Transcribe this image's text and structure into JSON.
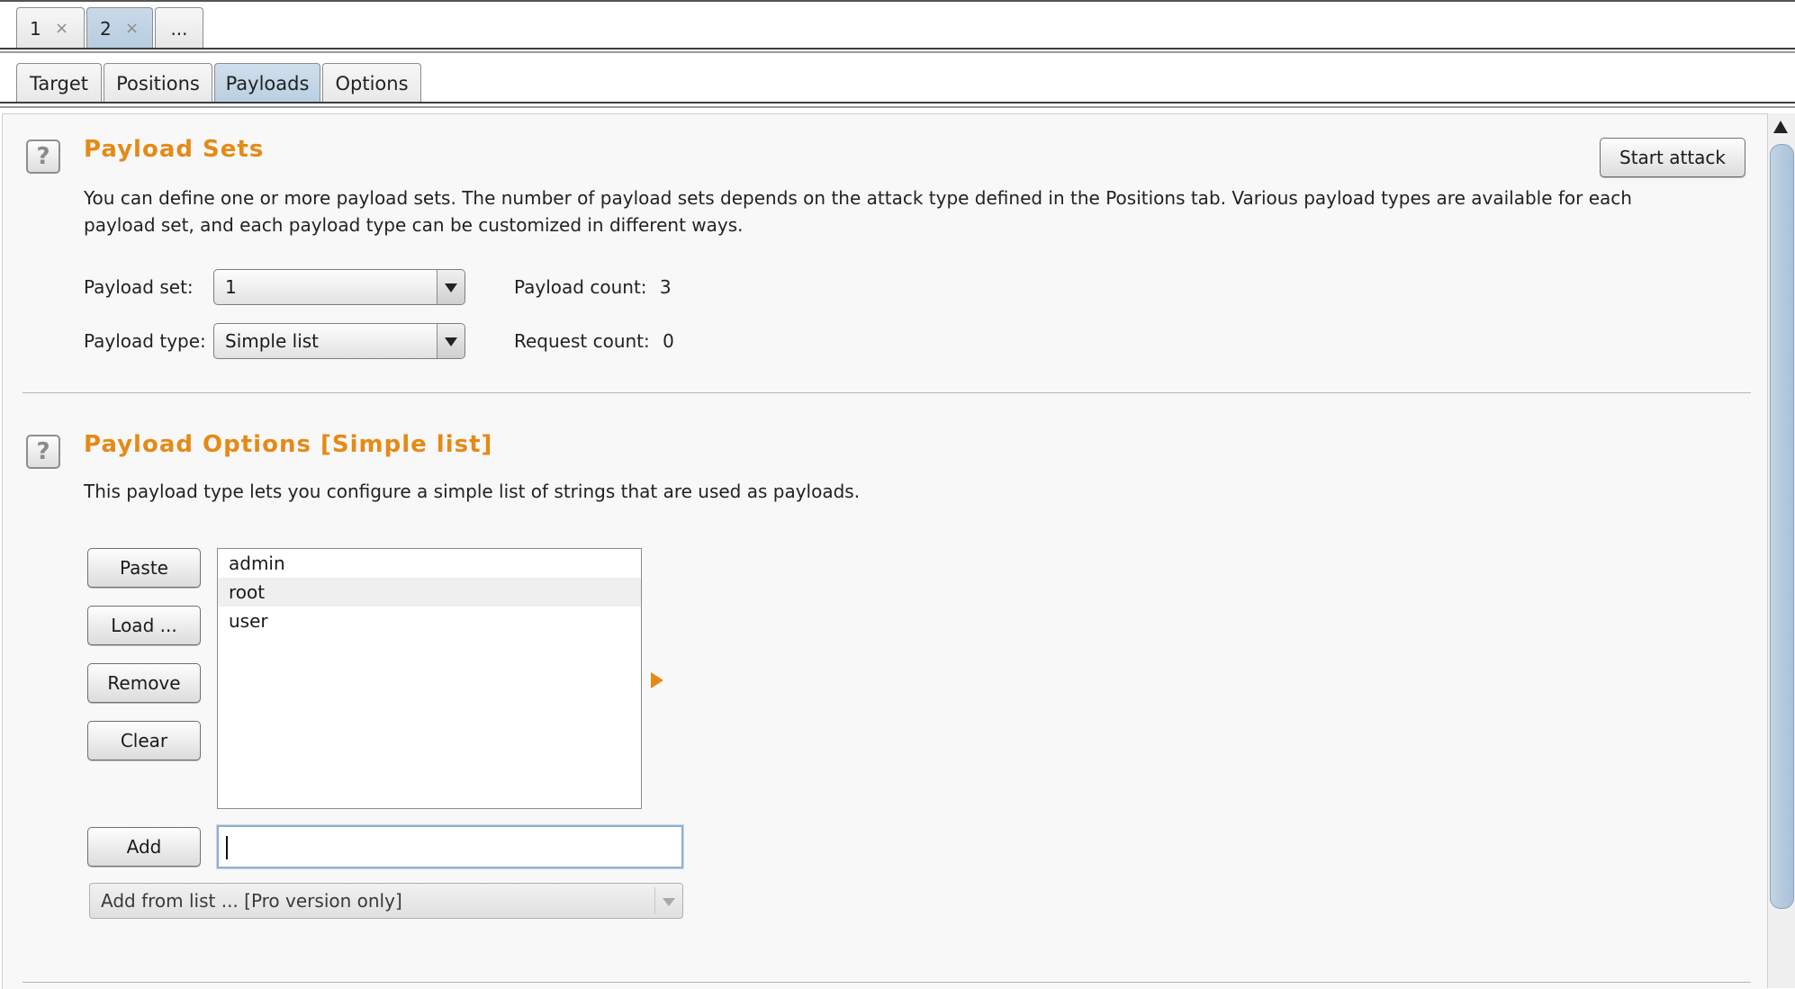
{
  "request_tabs": [
    {
      "label": "1",
      "close": "×"
    },
    {
      "label": "2",
      "close": "×"
    },
    {
      "label": "..."
    }
  ],
  "sub_tabs": [
    "Target",
    "Positions",
    "Payloads",
    "Options"
  ],
  "active_sub_tab": "Payloads",
  "payload_sets": {
    "help_icon": "?",
    "title": "Payload Sets",
    "start_attack_label": "Start attack",
    "description_line1": "You can define one or more payload sets. The number of payload sets depends on the attack type defined in the Positions tab. Various payload types are available for each",
    "description_line2": "payload set, and each payload type can be customized in different ways.",
    "payload_set_label": "Payload set:",
    "payload_set_value": "1",
    "payload_type_label": "Payload type:",
    "payload_type_value": "Simple list",
    "payload_count_label": "Payload count:",
    "payload_count_value": "3",
    "request_count_label": "Request count:",
    "request_count_value": "0"
  },
  "payload_options": {
    "help_icon": "?",
    "title": "Payload Options [Simple list]",
    "description": "This payload type lets you configure a simple list of strings that are used as payloads.",
    "buttons": {
      "paste": "Paste",
      "load": "Load ...",
      "remove": "Remove",
      "clear": "Clear",
      "add": "Add"
    },
    "list_items": [
      "admin",
      "root",
      "user"
    ],
    "add_input_value": "",
    "add_from_list_label": "Add from list ... [Pro version only]"
  },
  "colors": {
    "section_title": "#e58a17",
    "active_tab": "#b9cfe2",
    "scroll_thumb": "#a9c1d8"
  }
}
